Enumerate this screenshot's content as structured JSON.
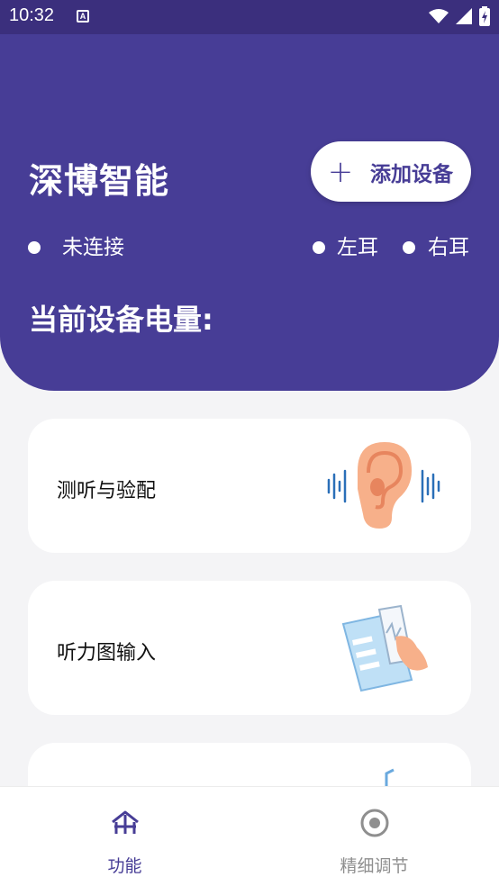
{
  "status_bar": {
    "time": "10:32",
    "notification_icon": "A"
  },
  "header": {
    "brand": "深博智能",
    "add_button_label": "添加设备",
    "connection_status": "未连接",
    "left_ear_label": "左耳",
    "right_ear_label": "右耳",
    "battery_label": "当前设备电量:"
  },
  "cards": [
    {
      "title": "测听与验配",
      "icon": "ear-sound-icon"
    },
    {
      "title": "听力图输入",
      "icon": "audiogram-tablet-icon"
    },
    {
      "title": "",
      "icon": "music-note-icon"
    }
  ],
  "bottom_nav": {
    "tabs": [
      {
        "label": "功能",
        "icon": "home-icon",
        "active": true
      },
      {
        "label": "精细调节",
        "icon": "target-icon",
        "active": false
      }
    ]
  },
  "colors": {
    "primary": "#473d96",
    "statusbar": "#3b2f7d",
    "background": "#f4f4f6"
  }
}
